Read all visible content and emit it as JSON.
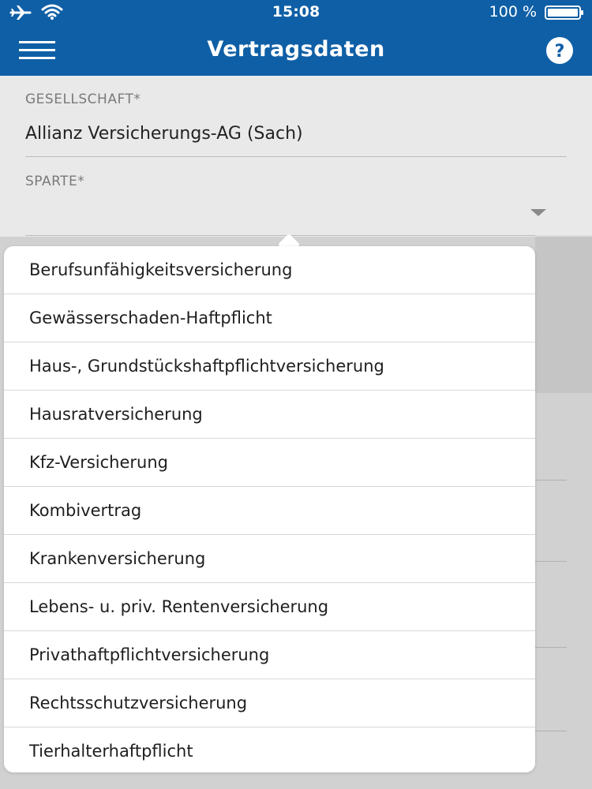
{
  "status_bar": {
    "time": "15:08",
    "battery": "100 %",
    "icons": [
      "airplane-icon",
      "wifi-icon",
      "battery-icon"
    ]
  },
  "nav": {
    "title": "Vertragsdaten",
    "menu_icon": "menu-icon",
    "help_icon": "help-icon",
    "help_glyph": "?"
  },
  "form": {
    "company": {
      "label": "GESELLSCHAFT*",
      "value": "Allianz Versicherungs-AG (Sach)"
    },
    "category": {
      "label": "SPARTE*",
      "value": ""
    }
  },
  "category_options": [
    "Berufsunfähigkeitsversicherung",
    "Gewässerschaden-Haftpflicht",
    "Haus-, Grundstückshaftpflichtversicherung",
    "Hausratversicherung",
    "Kfz-Versicherung",
    "Kombivertrag",
    "Krankenversicherung",
    "Lebens- u. priv. Rentenversicherung",
    "Privathaftpflichtversicherung",
    "Rechtsschutzversicherung",
    "Tierhalterhaftpflicht"
  ],
  "colors": {
    "header_background": "#0f5fa6",
    "header_text": "#ffffff",
    "form_background": "#e9e9e9",
    "popover_background": "#ffffff"
  }
}
